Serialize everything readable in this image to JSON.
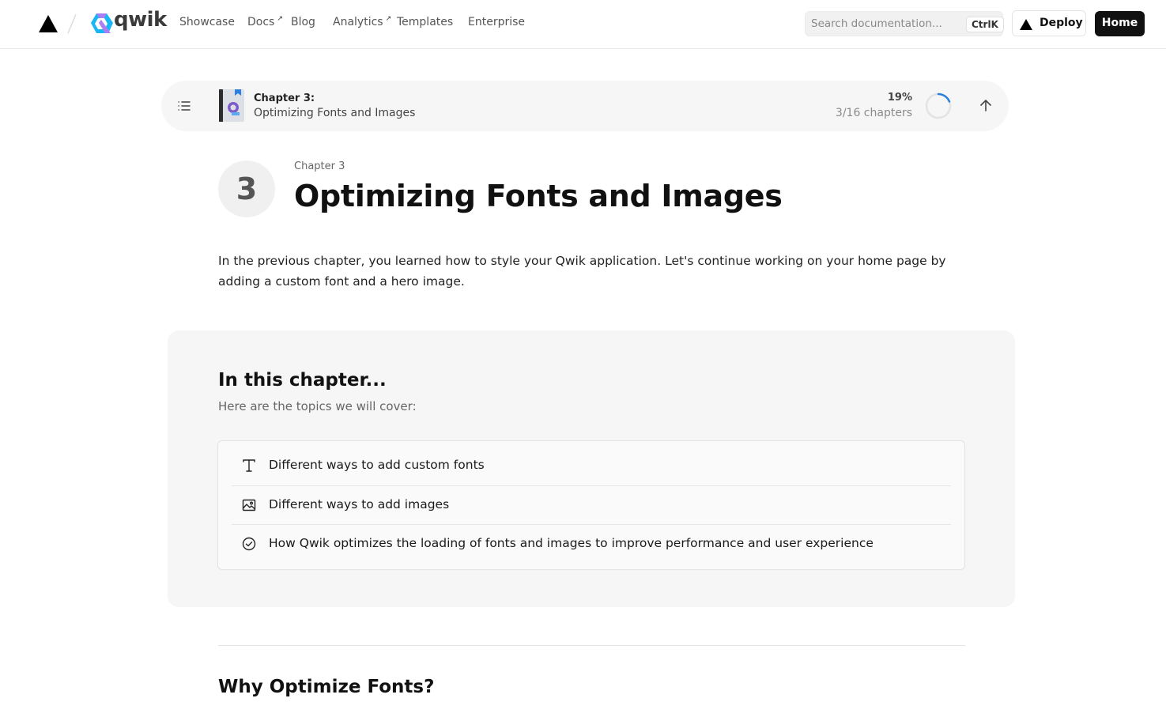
{
  "header": {
    "brand": "qwik",
    "nav": [
      {
        "label": "Showcase",
        "external": false
      },
      {
        "label": "Docs",
        "external": true
      },
      {
        "label": "Blog",
        "external": false
      },
      {
        "label": "Analytics",
        "external": true
      },
      {
        "label": "Templates",
        "external": false
      },
      {
        "label": "Enterprise",
        "external": false
      }
    ],
    "external_glyph": "↗",
    "search": {
      "placeholder": "Search documentation...",
      "value": "",
      "shortcut": "CtrlK"
    },
    "deploy_label": "Deploy",
    "home_label": "Home"
  },
  "progress": {
    "chapter_label": "Chapter 3:",
    "chapter_name": "Optimizing Fonts and Images",
    "percent_text": "19%",
    "percent_value": 0.19,
    "chapters_text": "3/16 chapters"
  },
  "chapter": {
    "number": "3",
    "label": "Chapter 3",
    "title": "Optimizing Fonts and Images",
    "intro": "In the previous chapter, you learned how to style your Qwik application. Let's continue working on your home page by adding a custom font and a hero image."
  },
  "overview": {
    "title": "In this chapter...",
    "subtitle": "Here are the topics we will cover:",
    "topics": [
      {
        "icon": "text-type-icon",
        "label": "Different ways to add custom fonts"
      },
      {
        "icon": "image-icon",
        "label": "Different ways to add images"
      },
      {
        "icon": "check-circle-icon",
        "label": "How Qwik optimizes the loading of fonts and images to improve performance and user experience"
      }
    ]
  },
  "next_section": {
    "title": "Why Optimize Fonts?"
  },
  "colors": {
    "accent": "#2b7fe0",
    "qwik_blue": "#18b6f6",
    "qwik_purple": "#ac7ef4",
    "dark": "#111111"
  }
}
